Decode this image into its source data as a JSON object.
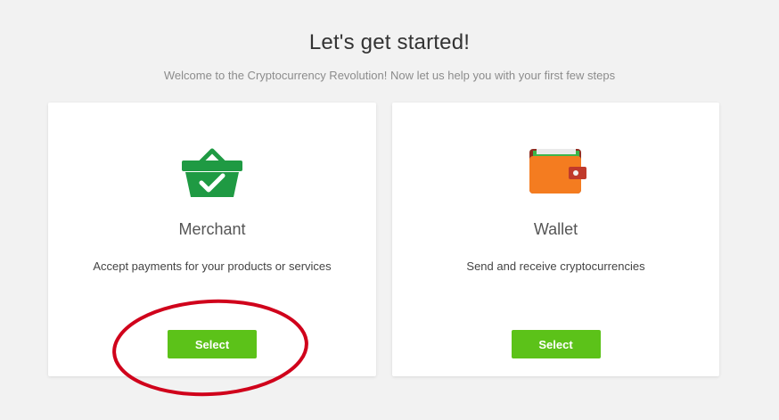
{
  "header": {
    "title": "Let's get started!",
    "subtitle": "Welcome to the Cryptocurrency Revolution! Now let us help you with your first few steps"
  },
  "cards": [
    {
      "icon": "shopping-basket-check-icon",
      "title": "Merchant",
      "description": "Accept payments for your products or services",
      "button_label": "Select"
    },
    {
      "icon": "wallet-icon",
      "title": "Wallet",
      "description": "Send and receive cryptocurrencies",
      "button_label": "Select"
    }
  ],
  "colors": {
    "background": "#f2f2f2",
    "button": "#5cc219",
    "basket_green": "#1f9a43",
    "wallet_orange": "#f47c20",
    "wallet_red": "#c0392b",
    "annotation_red": "#d0021b"
  }
}
